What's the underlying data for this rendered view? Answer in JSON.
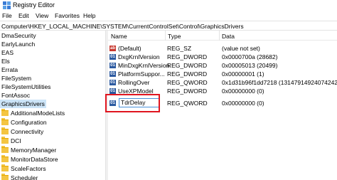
{
  "window": {
    "title": "Registry Editor",
    "icon": "registry-editor-icon"
  },
  "menu": [
    "File",
    "Edit",
    "View",
    "Favorites",
    "Help"
  ],
  "address": {
    "path": "Computer\\HKEY_LOCAL_MACHINE\\SYSTEM\\CurrentControlSet\\Control\\GraphicsDrivers"
  },
  "tree": {
    "items": [
      {
        "label": "DmaSecurity",
        "selected": false,
        "folder": false
      },
      {
        "label": "EarlyLaunch",
        "selected": false,
        "folder": false
      },
      {
        "label": "EAS",
        "selected": false,
        "folder": false
      },
      {
        "label": "Els",
        "selected": false,
        "folder": false
      },
      {
        "label": "Errata",
        "selected": false,
        "folder": false
      },
      {
        "label": "FileSystem",
        "selected": false,
        "folder": false
      },
      {
        "label": "FileSystemUtilities",
        "selected": false,
        "folder": false
      },
      {
        "label": "FontAssoc",
        "selected": false,
        "folder": false
      },
      {
        "label": "GraphicsDrivers",
        "selected": true,
        "folder": false
      },
      {
        "label": "AdditionalModeLists",
        "selected": false,
        "folder": true
      },
      {
        "label": "Configuration",
        "selected": false,
        "folder": true
      },
      {
        "label": "Connectivity",
        "selected": false,
        "folder": true
      },
      {
        "label": "DCI",
        "selected": false,
        "folder": true
      },
      {
        "label": "MemoryManager",
        "selected": false,
        "folder": true
      },
      {
        "label": "MonitorDataStore",
        "selected": false,
        "folder": true
      },
      {
        "label": "ScaleFactors",
        "selected": false,
        "folder": true
      },
      {
        "label": "Scheduler",
        "selected": false,
        "folder": true
      }
    ]
  },
  "values": {
    "columns": {
      "name": "Name",
      "type": "Type",
      "data": "Data"
    },
    "rows": [
      {
        "name": "(Default)",
        "type": "REG_SZ",
        "data": "(value not set)",
        "kind": "sz",
        "kind_label": "ab"
      },
      {
        "name": "DxgKrnlVersion",
        "type": "REG_DWORD",
        "data": "0x0000700a (28682)",
        "kind": "bin",
        "kind_label": "01"
      },
      {
        "name": "MinDxgKrnlVersion",
        "type": "REG_DWORD",
        "data": "0x00005013 (20499)",
        "kind": "bin",
        "kind_label": "01"
      },
      {
        "name": "PlatformSuppor...",
        "type": "REG_DWORD",
        "data": "0x00000001 (1)",
        "kind": "bin",
        "kind_label": "01"
      },
      {
        "name": "RollingOver",
        "type": "REG_QWORD",
        "data": "0x1d31b96f1dd7218 (131479149240742424)",
        "kind": "bin",
        "kind_label": "01"
      },
      {
        "name": "UseXPModel",
        "type": "REG_DWORD",
        "data": "0x00000000 (0)",
        "kind": "bin",
        "kind_label": "01"
      },
      {
        "name": "",
        "type": "REG_QWORD",
        "data": "0x00000000 (0)",
        "kind": "bin",
        "kind_label": "01"
      }
    ],
    "rename_value": "TdrDelay"
  }
}
